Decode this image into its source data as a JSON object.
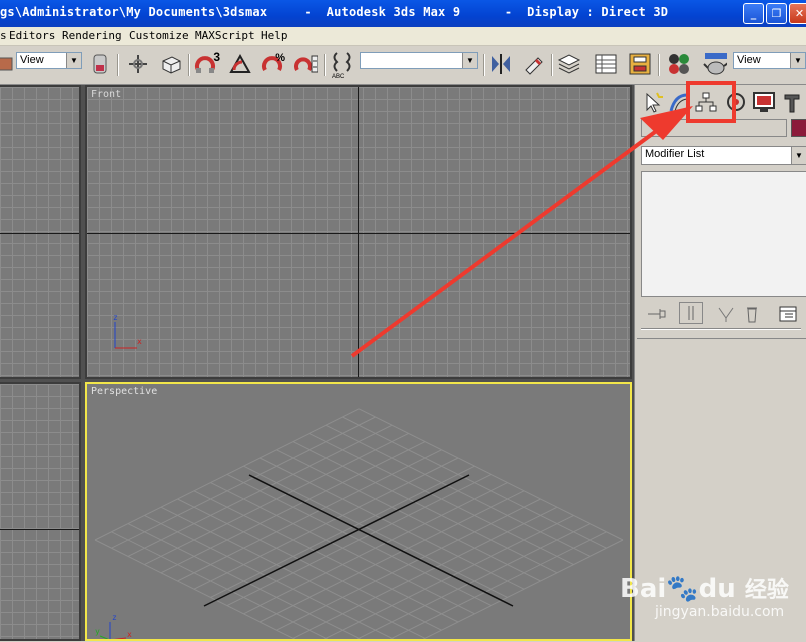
{
  "window": {
    "title": "gs\\Administrator\\My Documents\\3dsmax     -  Autodesk 3ds Max 9      -  Display : Direct 3D",
    "minimize_glyph": "_",
    "restore_glyph": "❐",
    "close_glyph": "✕"
  },
  "menu": {
    "items": [
      "Editors",
      "Rendering",
      "Customize",
      "MAXScript",
      "Help"
    ],
    "edge_fragment": "s"
  },
  "toolbar": {
    "view_combo_left": "View",
    "selection_set_combo": "",
    "view_combo_right": "View",
    "snap_3_label": "3",
    "percent_snap_label": "%",
    "abc_label": "ABC"
  },
  "viewports": {
    "front_label": "Front",
    "perspective_label": "Perspective",
    "axis_z": "z",
    "axis_x": "x",
    "axis_y": "y"
  },
  "command_panel": {
    "name_field": "",
    "modifier_list_label": "Modifier List",
    "color_swatch": "#8b1a3a"
  },
  "colors": {
    "highlight": "#ee3a2e",
    "perspective_border": "#f2e64a",
    "title_bar": "#0343d1"
  },
  "watermark": {
    "brand": "Bai",
    "brand_suffix": "du",
    "chinese": "经验",
    "url": "jingyan.baidu.com"
  }
}
